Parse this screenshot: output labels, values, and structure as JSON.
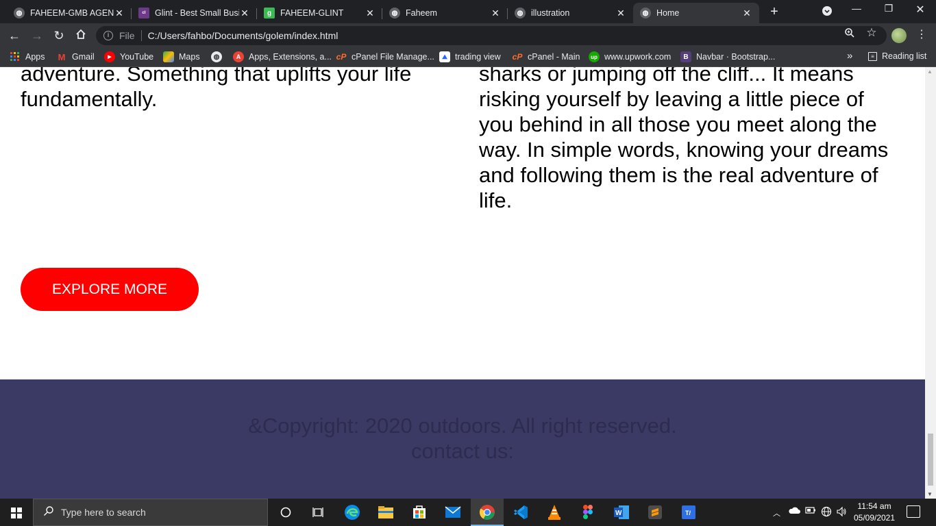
{
  "browser": {
    "tabs": [
      {
        "title": "FAHEEM-GMB AGENCY",
        "favicon": "globe-icon",
        "fav_color": "#5f6368"
      },
      {
        "title": "Glint - Best Small Business",
        "favicon": "colorlib-icon",
        "fav_color": "#6d3a8a"
      },
      {
        "title": "FAHEEM-GLINT",
        "favicon": "g-icon",
        "fav_color": "#3cba54"
      },
      {
        "title": "Faheem",
        "favicon": "globe-icon",
        "fav_color": "#5f6368"
      },
      {
        "title": "illustration",
        "favicon": "globe-icon",
        "fav_color": "#5f6368"
      },
      {
        "title": "Home",
        "favicon": "globe-icon",
        "fav_color": "#5f6368"
      }
    ],
    "close_glyph": "✕",
    "new_tab_glyph": "+",
    "address": {
      "protocol_label": "File",
      "url": "C:/Users/fahbo/Documents/golem/index.html"
    },
    "bookmarks": [
      {
        "label": "Apps",
        "icon": "apps-grid-icon"
      },
      {
        "label": "Gmail",
        "icon": "gmail-icon"
      },
      {
        "label": "YouTube",
        "icon": "youtube-icon"
      },
      {
        "label": "Maps",
        "icon": "maps-icon"
      },
      {
        "label": "",
        "icon": "globe-icon"
      },
      {
        "label": "Apps, Extensions, a...",
        "icon": "extensions-icon"
      },
      {
        "label": "cPanel File Manage...",
        "icon": "cpanel-icon"
      },
      {
        "label": "trading view",
        "icon": "tradingview-icon"
      },
      {
        "label": "cPanel - Main",
        "icon": "cpanel-icon"
      },
      {
        "label": "www.upwork.com",
        "icon": "upwork-icon"
      },
      {
        "label": "Navbar · Bootstrap...",
        "icon": "bootstrap-icon"
      }
    ],
    "bookmarks_more": "»",
    "reading_list": "Reading list"
  },
  "page": {
    "left_text_lines": [
      "adventure. Something that uplifts your life",
      "fundamentally."
    ],
    "right_text_lines": [
      "sharks or jumping off the cliff... It means",
      "risking yourself by leaving a little piece of",
      "you behind in all those you meet along the",
      "way. In simple words, knowing your dreams",
      "and following them is the real adventure of",
      "life."
    ],
    "explore_button": "EXPLORE MORE",
    "footer": {
      "copyright": "&Copyright: 2020 outdoors. All right reserved.",
      "contact": "contact us:"
    },
    "colors": {
      "button_bg": "#ff0000",
      "footer_bg": "#3b3a65",
      "footer_text": "#2d2c4f"
    }
  },
  "taskbar": {
    "search_placeholder": "Type here to search",
    "time": "11:54 am",
    "date": "05/09/2021",
    "apps": [
      "cortana-icon",
      "task-view-icon",
      "edge-icon",
      "file-explorer-icon",
      "store-icon",
      "mail-icon",
      "chrome-icon",
      "vscode-icon",
      "vlc-icon",
      "figma-icon",
      "word-icon",
      "sublime-icon",
      "typora-icon"
    ]
  }
}
